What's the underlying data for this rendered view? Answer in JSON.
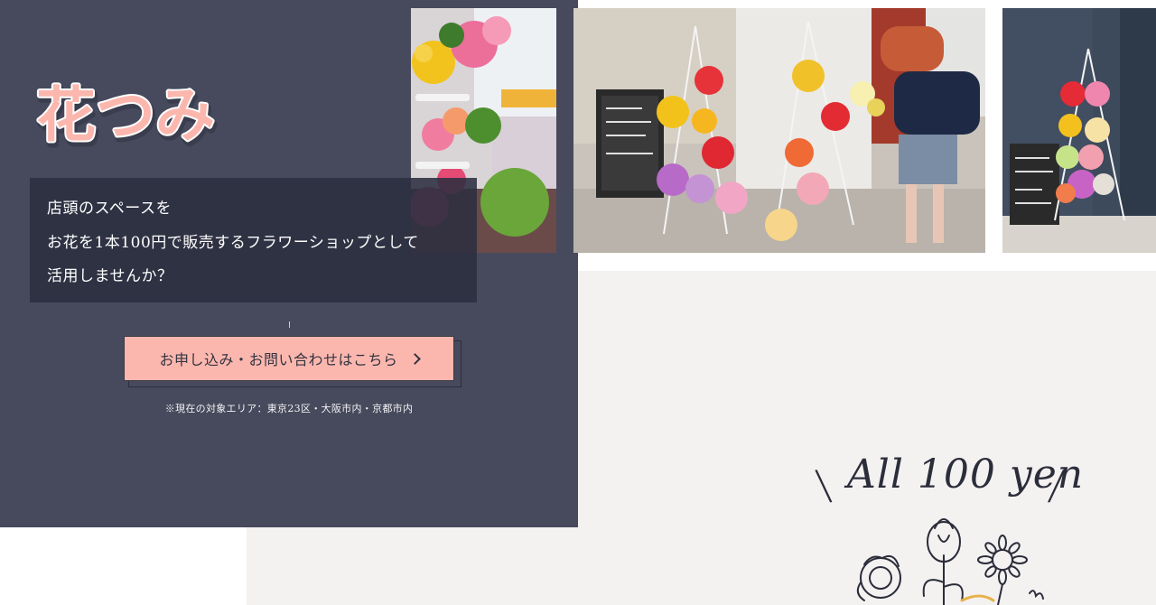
{
  "brand": {
    "logo_text": "花つみ",
    "accent_color": "#fbb7ae",
    "panel_color": "#474a5c"
  },
  "hero": {
    "message_lines": [
      "店頭のスペースを",
      "お花を1本100円で販売するフラワーショップとして",
      "活用しませんか？"
    ],
    "cta_label": "お申し込み・お問い合わせはこちら",
    "cta_icon": "chevron-right-icon",
    "area_note": "※現在の対象エリア：東京23区・大阪市内・京都市内"
  },
  "gallery": {
    "photos": [
      {
        "name": "flower-stand-closeup-photo"
      },
      {
        "name": "storefront-flower-shopper-photo"
      },
      {
        "name": "flower-stand-building-photo"
      }
    ]
  },
  "tagline": {
    "text": "All 100 yen",
    "slash_left": "\\",
    "slash_right": "/",
    "illustration_icon": "flower-illustration-icon"
  }
}
